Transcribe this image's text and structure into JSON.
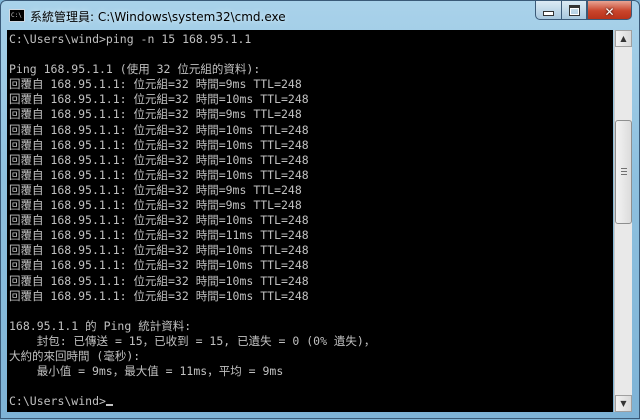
{
  "window": {
    "title": "系統管理員: C:\\Windows\\system32\\cmd.exe",
    "icon_text": "C:\\"
  },
  "controls": {
    "minimize": "minimize-icon",
    "maximize": "maximize-icon",
    "close_glyph": "✕"
  },
  "console": {
    "lines": [
      "C:\\Users\\wind>ping -n 15 168.95.1.1",
      "",
      "Ping 168.95.1.1 (使用 32 位元組的資料):",
      "回覆自 168.95.1.1: 位元組=32 時間=9ms TTL=248",
      "回覆自 168.95.1.1: 位元組=32 時間=10ms TTL=248",
      "回覆自 168.95.1.1: 位元組=32 時間=9ms TTL=248",
      "回覆自 168.95.1.1: 位元組=32 時間=10ms TTL=248",
      "回覆自 168.95.1.1: 位元組=32 時間=10ms TTL=248",
      "回覆自 168.95.1.1: 位元組=32 時間=10ms TTL=248",
      "回覆自 168.95.1.1: 位元組=32 時間=10ms TTL=248",
      "回覆自 168.95.1.1: 位元組=32 時間=9ms TTL=248",
      "回覆自 168.95.1.1: 位元組=32 時間=9ms TTL=248",
      "回覆自 168.95.1.1: 位元組=32 時間=10ms TTL=248",
      "回覆自 168.95.1.1: 位元組=32 時間=11ms TTL=248",
      "回覆自 168.95.1.1: 位元組=32 時間=10ms TTL=248",
      "回覆自 168.95.1.1: 位元組=32 時間=10ms TTL=248",
      "回覆自 168.95.1.1: 位元組=32 時間=10ms TTL=248",
      "回覆自 168.95.1.1: 位元組=32 時間=10ms TTL=248",
      "",
      "168.95.1.1 的 Ping 統計資料:",
      "    封包: 已傳送 = 15，已收到 = 15, 已遺失 = 0 (0% 遺失)，",
      "大約的來回時間 (毫秒):",
      "    最小值 = 9ms，最大值 = 11ms，平均 = 9ms",
      "",
      "C:\\Users\\wind>"
    ]
  },
  "scrollbar": {
    "up_icon": "▲",
    "down_icon": "▼",
    "position_fraction": 0.3
  }
}
